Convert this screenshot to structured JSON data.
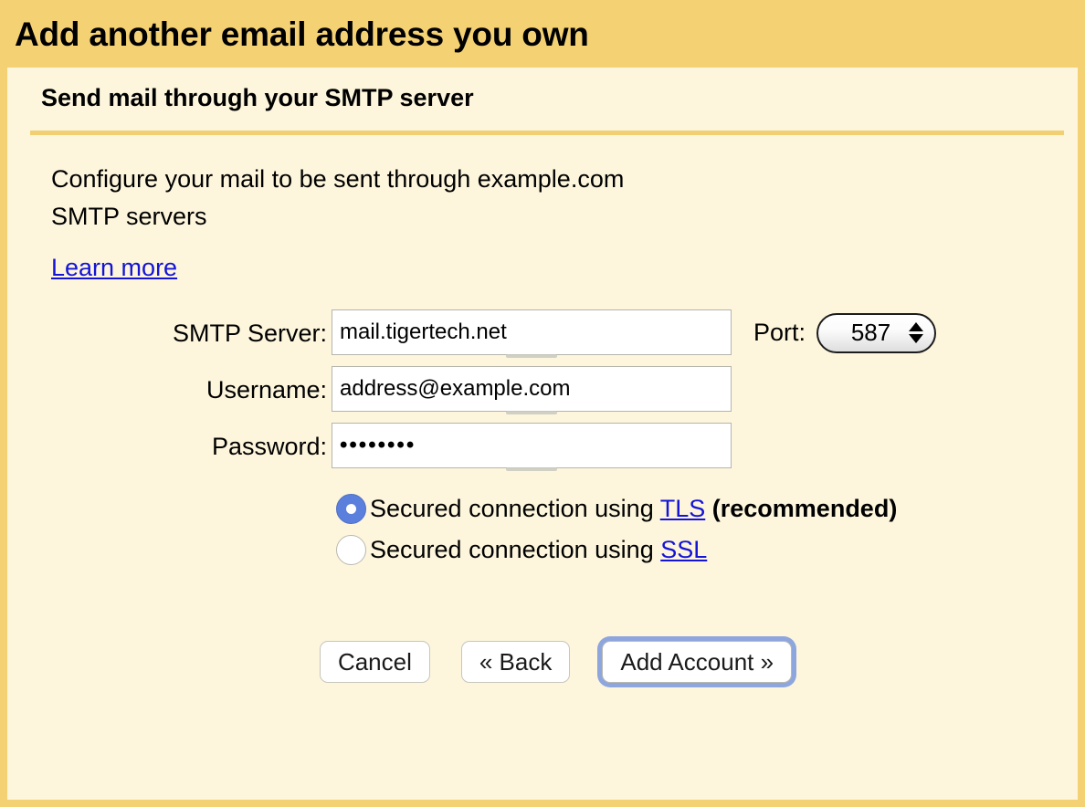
{
  "window": {
    "title": "Add another email address you own"
  },
  "panel": {
    "subtitle": "Send mail through your SMTP server",
    "intro_line_1": "Configure your mail to be sent through example.com",
    "intro_line_2": "SMTP servers",
    "learn_more_label": "Learn more"
  },
  "form": {
    "smtp_server": {
      "label": "SMTP Server:",
      "value": "mail.tigertech.net",
      "placeholder": ""
    },
    "username": {
      "label": "Username:",
      "value": "address@example.com",
      "placeholder": ""
    },
    "password": {
      "label": "Password:",
      "value": "••••••••",
      "placeholder": ""
    },
    "port": {
      "label": "Port:",
      "value": "587",
      "up_icon": "stepper-up-arrow-icon",
      "down_icon": "stepper-down-arrow-icon"
    }
  },
  "security": {
    "options": [
      {
        "id": "tls",
        "prefix": "Secured connection using ",
        "link": "TLS",
        "suffix": " (recommended)",
        "selected": true
      },
      {
        "id": "ssl",
        "prefix": "Secured connection using ",
        "link": "SSL",
        "suffix": "",
        "selected": false
      }
    ]
  },
  "buttons": {
    "cancel": "Cancel",
    "back": "« Back",
    "add_account": "Add Account »"
  },
  "colors": {
    "header_gold": "#f4d173",
    "panel_cream": "#fdf6dd",
    "divider_gold": "#f2d072",
    "link_blue": "#1414d6",
    "radio_selected_blue": "#5b7fdd",
    "focus_ring_blue": "#8ea6de",
    "input_white": "#ffffff"
  }
}
